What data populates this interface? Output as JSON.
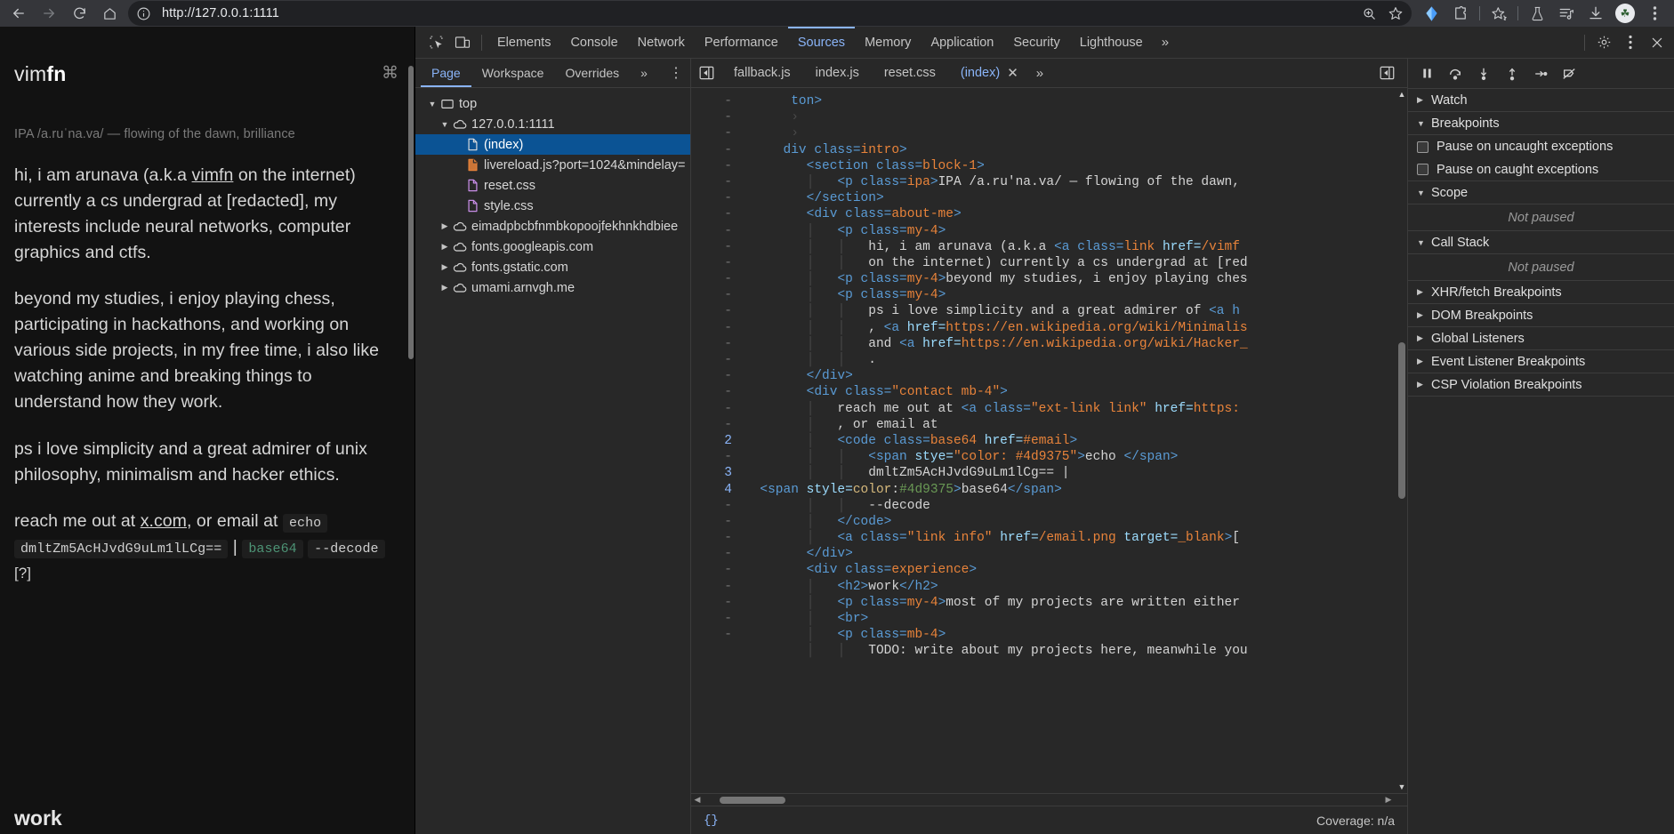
{
  "browser": {
    "nav": {
      "back": "back-arrow",
      "forward": "forward-arrow",
      "reload": "reload",
      "home": "home"
    },
    "url": "http://127.0.0.1:1111",
    "omnibox_icons": [
      "zoom-in-icon",
      "bookmark-star-icon"
    ],
    "chrome_icons": [
      "blue-drop-icon",
      "extensions-puzzle-icon",
      "star-sparkle-icon",
      "flask-icon",
      "reading-list-icon",
      "download-icon"
    ],
    "avatar_label": "☘",
    "menu": "three-dot-menu"
  },
  "page": {
    "logo_prefix": "vim",
    "logo_suffix": "fn",
    "cmd_glyph": "⌘",
    "ipa": "IPA /a.ruˈna.va/ — flowing of the dawn, brilliance",
    "p1_a": "hi, i am arunava (a.k.a ",
    "p1_link": "vimfn",
    "p1_b": " on the internet) currently a cs undergrad at [redacted], my interests include neural networks, computer graphics and ctfs.",
    "p2": "beyond my studies, i enjoy playing chess, participating in hackathons, and working on various side projects, in my free time, i also like watching anime and breaking things to understand how they work.",
    "p3": "ps i love simplicity and a great admirer of unix philosophy, minimalism and hacker ethics.",
    "p4_a": "reach me out at ",
    "p4_link": "x.com",
    "p4_b": ", or email at ",
    "code_echo": "echo",
    "code_b64": "dmltZm5AcHJvdG9uLm1lLCg==",
    "code_pipe": "|",
    "code_base64": "base64",
    "code_decode": "--decode",
    "help": "[?]",
    "footer": "work"
  },
  "devtools": {
    "left_icons": [
      "inspect-element-icon",
      "device-toolbar-icon"
    ],
    "panels": [
      "Elements",
      "Console",
      "Network",
      "Performance",
      "Sources",
      "Memory",
      "Application",
      "Security",
      "Lighthouse"
    ],
    "active_panel": "Sources",
    "overflow": "»",
    "right_icons": [
      "settings-gear-icon",
      "three-dot-menu-icon",
      "close-icon"
    ],
    "navigator": {
      "tabs": [
        "Page",
        "Workspace",
        "Overrides"
      ],
      "active_tab": "Page",
      "overflow": "»",
      "menu": "⋮",
      "tree": [
        {
          "label": "top",
          "icon": "frame-icon",
          "depth": 0,
          "caret": "down",
          "selected": false
        },
        {
          "label": "127.0.0.1:1111",
          "icon": "cloud-icon",
          "depth": 1,
          "caret": "down",
          "selected": false
        },
        {
          "label": "(index)",
          "icon": "doc-white-icon",
          "depth": 2,
          "caret": "none",
          "selected": true
        },
        {
          "label": "livereload.js?port=1024&mindelay=",
          "icon": "doc-orange-icon",
          "depth": 2,
          "caret": "none",
          "selected": false
        },
        {
          "label": "reset.css",
          "icon": "doc-purple-icon",
          "depth": 2,
          "caret": "none",
          "selected": false
        },
        {
          "label": "style.css",
          "icon": "doc-purple-icon",
          "depth": 2,
          "caret": "none",
          "selected": false
        },
        {
          "label": "eimadpbcbfnmbkopoojfekhnkhdbiee",
          "icon": "cloud-icon",
          "depth": 1,
          "caret": "right",
          "selected": false
        },
        {
          "label": "fonts.googleapis.com",
          "icon": "cloud-icon",
          "depth": 1,
          "caret": "right",
          "selected": false
        },
        {
          "label": "fonts.gstatic.com",
          "icon": "cloud-icon",
          "depth": 1,
          "caret": "right",
          "selected": false
        },
        {
          "label": "umami.arnvgh.me",
          "icon": "cloud-icon",
          "depth": 1,
          "caret": "right",
          "selected": false
        }
      ]
    },
    "file_tabs": {
      "sidebar_toggle": "panel-toggle-icon",
      "items": [
        {
          "label": "fallback.js",
          "active": false,
          "closable": false
        },
        {
          "label": "index.js",
          "active": false,
          "closable": false
        },
        {
          "label": "reset.css",
          "active": false,
          "closable": false
        },
        {
          "label": "(index)",
          "active": true,
          "closable": true
        }
      ],
      "close_glyph": "✕",
      "overflow": "»",
      "right_icon": "panel-toggle-right-icon"
    },
    "gutter": [
      "-",
      "-",
      "-",
      "-",
      "-",
      "-",
      "-",
      "-",
      "-",
      "-",
      "-",
      "-",
      "-",
      "-",
      "-",
      "-",
      "-",
      "-",
      "-",
      "-",
      "-",
      "2",
      "-",
      "3",
      "4",
      "-",
      "-",
      "-",
      "-",
      "-",
      "-",
      "-",
      "-",
      "-"
    ],
    "code_lines": [
      [
        [
          "pl",
          "      "
        ],
        [
          "t",
          "ton>"
        ]
      ],
      [
        [
          "pl",
          "      "
        ],
        [
          "guide",
          "›"
        ]
      ],
      [
        [
          "pl",
          "      "
        ],
        [
          "guide",
          "›"
        ]
      ],
      [
        [
          "pl",
          "     "
        ],
        [
          "t",
          "div class="
        ],
        [
          "av",
          "intro"
        ],
        [
          "t",
          ">"
        ]
      ],
      [
        [
          "pl",
          "        "
        ],
        [
          "t",
          "<section class="
        ],
        [
          "av",
          "block-1"
        ],
        [
          "t",
          ">"
        ]
      ],
      [
        [
          "pl",
          "        "
        ],
        [
          "guide",
          "│"
        ],
        [
          "pl",
          "   "
        ],
        [
          "t",
          "<p class="
        ],
        [
          "av",
          "ipa"
        ],
        [
          "t",
          ">"
        ],
        [
          "pl",
          "IPA /a.ru'na.va/ — flowing of the dawn, "
        ]
      ],
      [
        [
          "pl",
          "        "
        ],
        [
          "t",
          "</section>"
        ]
      ],
      [
        [
          "pl",
          "        "
        ],
        [
          "t",
          "<div class="
        ],
        [
          "av",
          "about-me"
        ],
        [
          "t",
          ">"
        ]
      ],
      [
        [
          "pl",
          "        "
        ],
        [
          "guide",
          "│"
        ],
        [
          "pl",
          "   "
        ],
        [
          "t",
          "<p class="
        ],
        [
          "av",
          "my-4"
        ],
        [
          "t",
          ">"
        ]
      ],
      [
        [
          "pl",
          "        "
        ],
        [
          "guide",
          "│"
        ],
        [
          "pl",
          "   "
        ],
        [
          "guide",
          "│"
        ],
        [
          "pl",
          "   hi, i am arunava (a.k.a "
        ],
        [
          "t",
          "<a class="
        ],
        [
          "av",
          "link"
        ],
        [
          "pl",
          " "
        ],
        [
          "an",
          "href="
        ],
        [
          "av",
          "/vimf"
        ]
      ],
      [
        [
          "pl",
          "        "
        ],
        [
          "guide",
          "│"
        ],
        [
          "pl",
          "   "
        ],
        [
          "guide",
          "│"
        ],
        [
          "pl",
          "   on the internet) currently a cs undergrad at [red"
        ]
      ],
      [
        [
          "pl",
          "        "
        ],
        [
          "guide",
          "│"
        ],
        [
          "pl",
          "   "
        ],
        [
          "t",
          "<p class="
        ],
        [
          "av",
          "my-4"
        ],
        [
          "t",
          ">"
        ],
        [
          "pl",
          "beyond my studies, i enjoy playing ches"
        ]
      ],
      [
        [
          "pl",
          "        "
        ],
        [
          "guide",
          "│"
        ],
        [
          "pl",
          "   "
        ],
        [
          "t",
          "<p class="
        ],
        [
          "av",
          "my-4"
        ],
        [
          "t",
          ">"
        ]
      ],
      [
        [
          "pl",
          "        "
        ],
        [
          "guide",
          "│"
        ],
        [
          "pl",
          "   "
        ],
        [
          "guide",
          "│"
        ],
        [
          "pl",
          "   ps i love simplicity and a great admirer of "
        ],
        [
          "t",
          "<a h"
        ]
      ],
      [
        [
          "pl",
          "        "
        ],
        [
          "guide",
          "│"
        ],
        [
          "pl",
          "   "
        ],
        [
          "guide",
          "│"
        ],
        [
          "pl",
          "   , "
        ],
        [
          "t",
          "<a "
        ],
        [
          "an",
          "href="
        ],
        [
          "av",
          "https://en.wikipedia.org/wiki/Minimalis"
        ]
      ],
      [
        [
          "pl",
          "        "
        ],
        [
          "guide",
          "│"
        ],
        [
          "pl",
          "   "
        ],
        [
          "guide",
          "│"
        ],
        [
          "pl",
          "   and "
        ],
        [
          "t",
          "<a "
        ],
        [
          "an",
          "href="
        ],
        [
          "av",
          "https://en.wikipedia.org/wiki/Hacker_"
        ]
      ],
      [
        [
          "pl",
          "        "
        ],
        [
          "guide",
          "│"
        ],
        [
          "pl",
          "   "
        ],
        [
          "guide",
          "│"
        ],
        [
          "pl",
          "   ."
        ]
      ],
      [
        [
          "pl",
          "        "
        ],
        [
          "t",
          "</div>"
        ]
      ],
      [
        [
          "pl",
          "        "
        ],
        [
          "t",
          "<div class="
        ],
        [
          "av",
          "\"contact mb-4\""
        ],
        [
          "t",
          ">"
        ]
      ],
      [
        [
          "pl",
          "        "
        ],
        [
          "guide",
          "│"
        ],
        [
          "pl",
          "   reach me out at "
        ],
        [
          "t",
          "<a class="
        ],
        [
          "av",
          "\"ext-link link\""
        ],
        [
          "pl",
          " "
        ],
        [
          "an",
          "href="
        ],
        [
          "av",
          "https:"
        ]
      ],
      [
        [
          "pl",
          "        "
        ],
        [
          "guide",
          "│"
        ],
        [
          "pl",
          "   , or email at"
        ]
      ],
      [
        [
          "pl",
          "        "
        ],
        [
          "guide",
          "│"
        ],
        [
          "pl",
          "   "
        ],
        [
          "t",
          "<code class="
        ],
        [
          "av",
          "base64"
        ],
        [
          "pl",
          " "
        ],
        [
          "an",
          "href="
        ],
        [
          "av",
          "#email"
        ],
        [
          "t",
          ">"
        ]
      ],
      [
        [
          "pl",
          "        "
        ],
        [
          "guide",
          "│"
        ],
        [
          "pl",
          "   "
        ],
        [
          "guide",
          "│"
        ],
        [
          "pl",
          "   "
        ],
        [
          "t",
          "<span "
        ],
        [
          "an",
          "stye="
        ],
        [
          "av",
          "\"color: #4d9375\""
        ],
        [
          "t",
          ">"
        ],
        [
          "pl",
          "echo "
        ],
        [
          "t",
          "</span>"
        ]
      ],
      [
        [
          "pl",
          "        "
        ],
        [
          "guide",
          "│"
        ],
        [
          "pl",
          "   "
        ],
        [
          "guide",
          "│"
        ],
        [
          "pl",
          "   dmltZm5AcHJvdG9uLm1lCg== |"
        ]
      ],
      [
        [
          "pl",
          "  "
        ],
        [
          "t",
          "<span "
        ],
        [
          "an",
          "style="
        ],
        [
          "pr",
          "color"
        ],
        [
          "pl",
          ":"
        ],
        [
          "vl",
          "#4d9375"
        ],
        [
          "t",
          ">"
        ],
        [
          "pl",
          "base64"
        ],
        [
          "t",
          "</span>"
        ]
      ],
      [
        [
          "pl",
          "        "
        ],
        [
          "guide",
          "│"
        ],
        [
          "pl",
          "   "
        ],
        [
          "guide",
          "│"
        ],
        [
          "pl",
          "   --decode"
        ]
      ],
      [
        [
          "pl",
          "        "
        ],
        [
          "guide",
          "│"
        ],
        [
          "pl",
          "   "
        ],
        [
          "t",
          "</code>"
        ]
      ],
      [
        [
          "pl",
          "        "
        ],
        [
          "guide",
          "│"
        ],
        [
          "pl",
          "   "
        ],
        [
          "t",
          "<a class="
        ],
        [
          "av",
          "\"link info\""
        ],
        [
          "pl",
          " "
        ],
        [
          "an",
          "href="
        ],
        [
          "av",
          "/email.png"
        ],
        [
          "pl",
          " "
        ],
        [
          "an",
          "target="
        ],
        [
          "av",
          "_blank"
        ],
        [
          "t",
          ">"
        ],
        [
          "pl",
          "["
        ]
      ],
      [
        [
          "pl",
          "        "
        ],
        [
          "t",
          "</div>"
        ]
      ],
      [
        [
          "pl",
          "        "
        ],
        [
          "t",
          "<div class="
        ],
        [
          "av",
          "experience"
        ],
        [
          "t",
          ">"
        ]
      ],
      [
        [
          "pl",
          "        "
        ],
        [
          "guide",
          "│"
        ],
        [
          "pl",
          "   "
        ],
        [
          "t",
          "<h2>"
        ],
        [
          "pl",
          "work"
        ],
        [
          "t",
          "</h2>"
        ]
      ],
      [
        [
          "pl",
          "        "
        ],
        [
          "guide",
          "│"
        ],
        [
          "pl",
          "   "
        ],
        [
          "t",
          "<p class="
        ],
        [
          "av",
          "my-4"
        ],
        [
          "t",
          ">"
        ],
        [
          "pl",
          "most of my projects are written either"
        ]
      ],
      [
        [
          "pl",
          "        "
        ],
        [
          "guide",
          "│"
        ],
        [
          "pl",
          "   "
        ],
        [
          "t",
          "<br>"
        ]
      ],
      [
        [
          "pl",
          "        "
        ],
        [
          "guide",
          "│"
        ],
        [
          "pl",
          "   "
        ],
        [
          "t",
          "<p class="
        ],
        [
          "av",
          "mb-4"
        ],
        [
          "t",
          ">"
        ]
      ],
      [
        [
          "pl",
          "        "
        ],
        [
          "guide",
          "│"
        ],
        [
          "pl",
          "   "
        ],
        [
          "guide",
          "│"
        ],
        [
          "pl",
          "   TODO: write about my projects here, meanwhile you"
        ]
      ]
    ],
    "status": {
      "format_icon": "{}",
      "coverage": "Coverage: n/a"
    },
    "debugger": {
      "toolbar": [
        "pause-resume-icon",
        "step-over-icon",
        "step-into-icon",
        "step-out-icon",
        "step-icon",
        "deactivate-breakpoints-icon"
      ],
      "sections": [
        {
          "name": "Watch",
          "expanded": false,
          "type": "header"
        },
        {
          "name": "Breakpoints",
          "expanded": true,
          "type": "header"
        },
        {
          "name": "Pause on uncaught exceptions",
          "type": "checkbox",
          "checked": false
        },
        {
          "name": "Pause on caught exceptions",
          "type": "checkbox",
          "checked": false
        },
        {
          "name": "Scope",
          "expanded": true,
          "type": "header"
        },
        {
          "name": "Not paused",
          "type": "empty"
        },
        {
          "name": "Call Stack",
          "expanded": true,
          "type": "header"
        },
        {
          "name": "Not paused",
          "type": "empty"
        },
        {
          "name": "XHR/fetch Breakpoints",
          "expanded": false,
          "type": "header"
        },
        {
          "name": "DOM Breakpoints",
          "expanded": false,
          "type": "header"
        },
        {
          "name": "Global Listeners",
          "expanded": false,
          "type": "header"
        },
        {
          "name": "Event Listener Breakpoints",
          "expanded": false,
          "type": "header"
        },
        {
          "name": "CSP Violation Breakpoints",
          "expanded": false,
          "type": "header"
        }
      ]
    }
  },
  "colors": {
    "accent": "#8ab4f8",
    "selection": "#0b5394",
    "chrome_bg": "#35363a",
    "devtools_bg": "#282828",
    "page_bg": "#121212"
  }
}
